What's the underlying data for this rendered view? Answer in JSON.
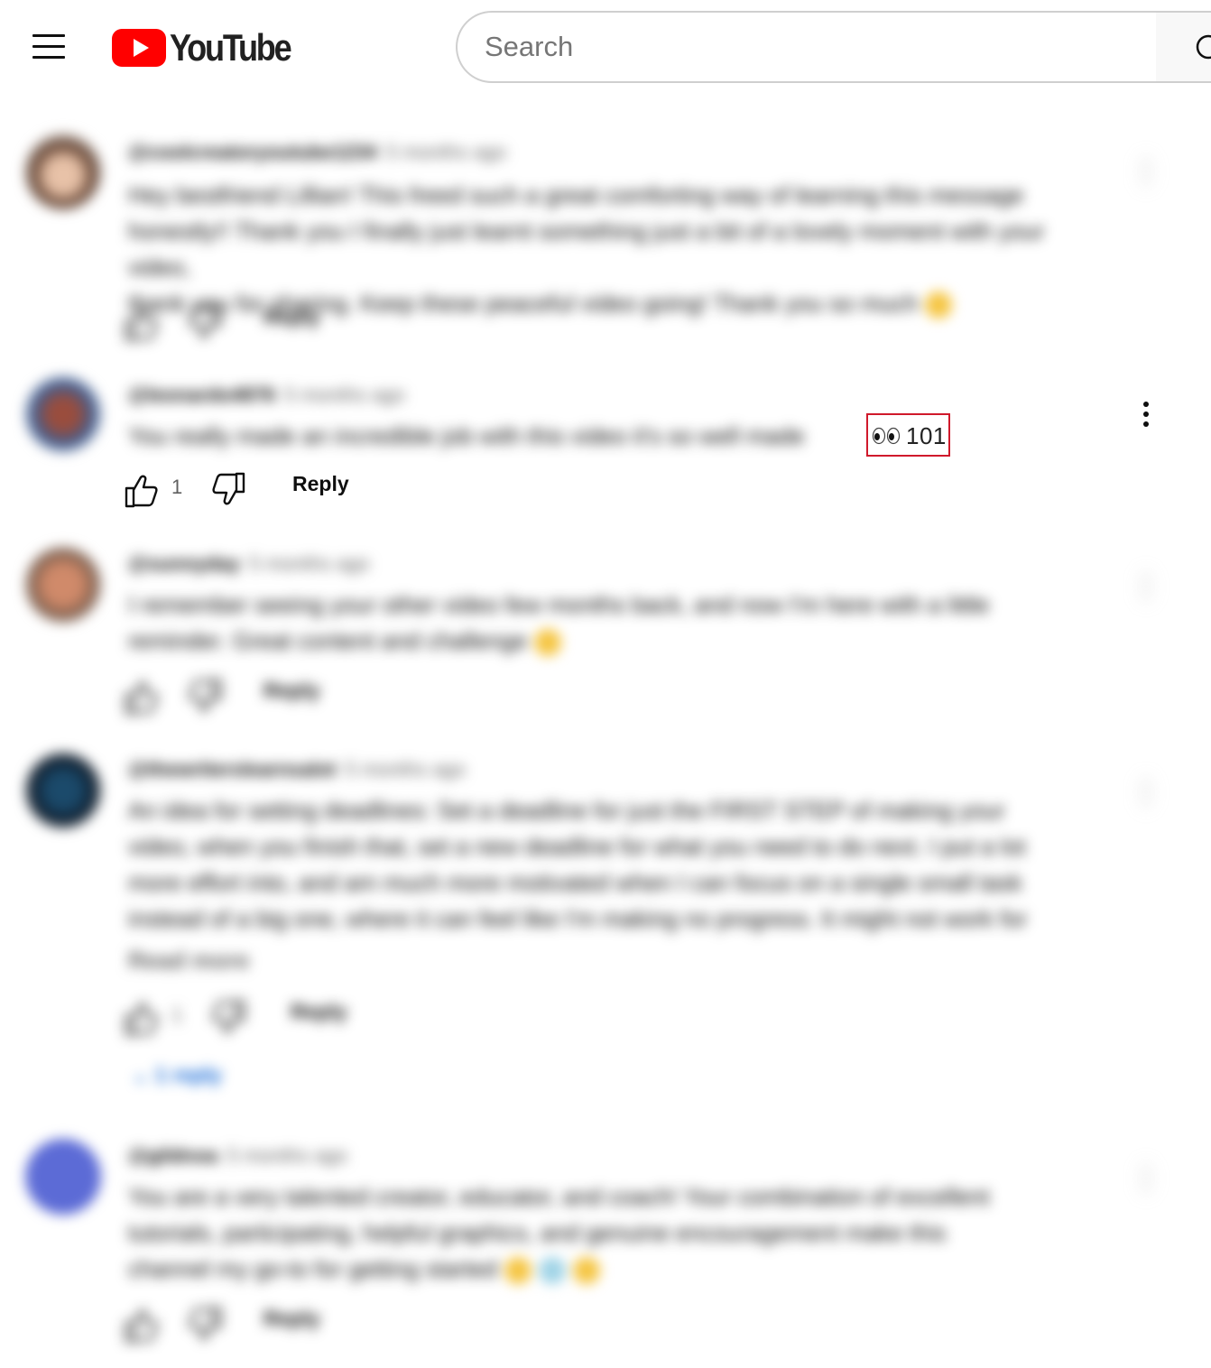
{
  "header": {
    "logo_text": "YouTube",
    "search_placeholder": "Search"
  },
  "comments": [
    {
      "author": "@coolcreatoryoutube1234",
      "time": "5 months ago",
      "lines": [
        "Hey bestfriend Lillian! This freed such a great comforting way of learning this message",
        "honestly!! Thank you I finally just learnt something just a bit of a lovely moment with your video,",
        "thank you for sharing. Keep these peaceful video going! Thank you so much"
      ],
      "reply_label": "Reply"
    },
    {
      "author": "@leonardo4876",
      "time": "5 months ago",
      "text": "You really made an incredible job with this video it's so well made",
      "highlight_count": "101",
      "like_count": "1",
      "reply_label": "Reply"
    },
    {
      "author": "@sunnyday",
      "time": "5 months ago",
      "lines": [
        "I remember seeing your other video few months back, and now I'm here with a little",
        "reminder. Great content and challenge"
      ],
      "reply_label": "Reply"
    },
    {
      "author": "@thewriterslearnsalot",
      "time": "5 months ago",
      "lines": [
        "An idea for setting deadlines: Set a deadline for just the FIRST STEP of making your",
        "video, when you finish that, set a new deadline for what you need to do next. I put a lot",
        "more effort into, and am much more motivated when I can focus on a single small task",
        "instead of a big one, where it can feel like I'm making no progress. It might not work for",
        "Read more"
      ],
      "like_count": "1",
      "reply_label": "Reply",
      "replies_label": "1 reply"
    },
    {
      "author": "@gildnoa",
      "time": "5 months ago",
      "lines": [
        "You are a very talented creator, educator, and coach! Your combination of excellent",
        "tutorials, participating, helpful graphics, and genuine encouragement make this",
        "channel my go-to for getting started"
      ],
      "reply_label": "Reply"
    }
  ]
}
